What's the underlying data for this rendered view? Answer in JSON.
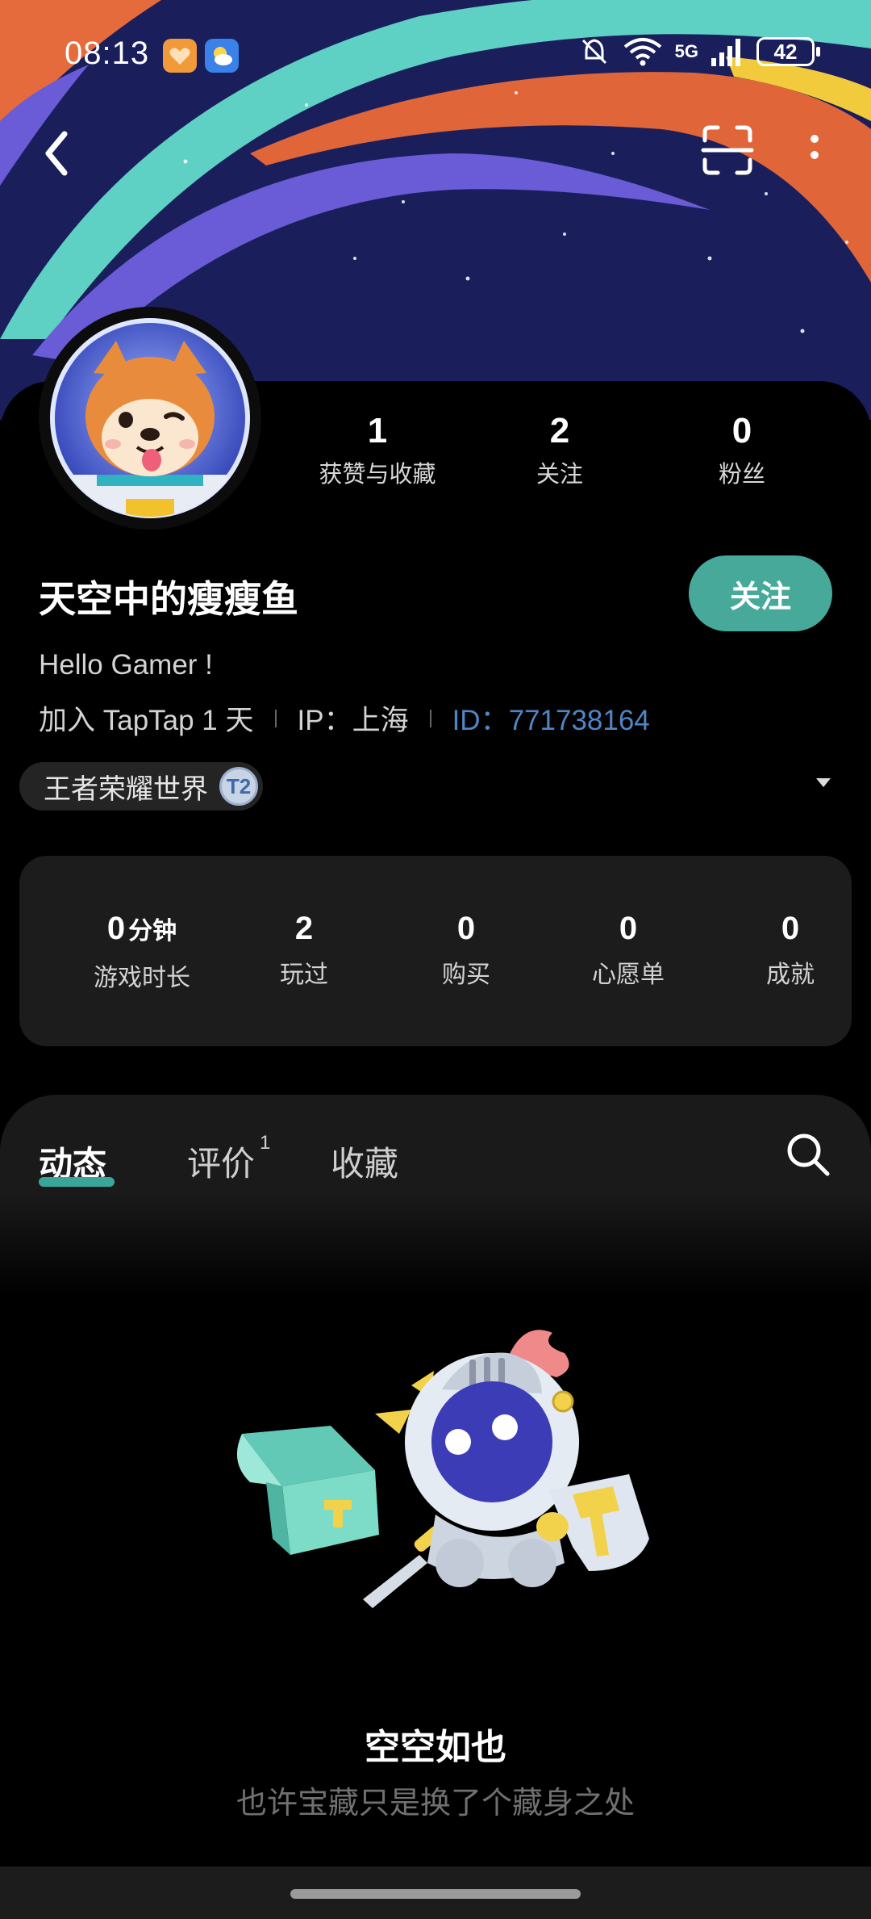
{
  "status_bar": {
    "time": "08:13",
    "network": "5G",
    "battery": "42"
  },
  "profile": {
    "stats": [
      {
        "value": "1",
        "label": "获赞与收藏"
      },
      {
        "value": "2",
        "label": "关注"
      },
      {
        "value": "0",
        "label": "粉丝"
      }
    ],
    "username": "天空中的瘦瘦鱼",
    "follow_label": "关注",
    "bio": "Hello Gamer !",
    "joined": "加入 TapTap 1 天",
    "ip": "IP：上海",
    "id": "ID：771738164",
    "game_chip": "王者荣耀世界",
    "game_chip_badge": "T2"
  },
  "game_stats": [
    {
      "value": "0",
      "unit": "分钟",
      "label": "游戏时长"
    },
    {
      "value": "2",
      "unit": "",
      "label": "玩过"
    },
    {
      "value": "0",
      "unit": "",
      "label": "购买"
    },
    {
      "value": "0",
      "unit": "",
      "label": "心愿单"
    },
    {
      "value": "0",
      "unit": "",
      "label": "成就"
    }
  ],
  "tabs": [
    {
      "label": "动态",
      "badge": ""
    },
    {
      "label": "评价",
      "badge": "1"
    },
    {
      "label": "收藏",
      "badge": ""
    }
  ],
  "empty_state": {
    "title": "空空如也",
    "subtitle": "也许宝藏只是换了个藏身之处"
  },
  "colors": {
    "accent": "#47a99a",
    "id_link": "#4f86c6",
    "banner_navy": "#1a1f5c",
    "stripe_orange": "#e0663a",
    "stripe_teal": "#5fd0c4",
    "stripe_purple": "#6a5bd6"
  },
  "icons": [
    "back-icon",
    "scan-icon",
    "more-icon",
    "search-icon",
    "chevron-down-icon",
    "mute-icon",
    "wifi-icon",
    "signal-icon",
    "battery-icon"
  ]
}
